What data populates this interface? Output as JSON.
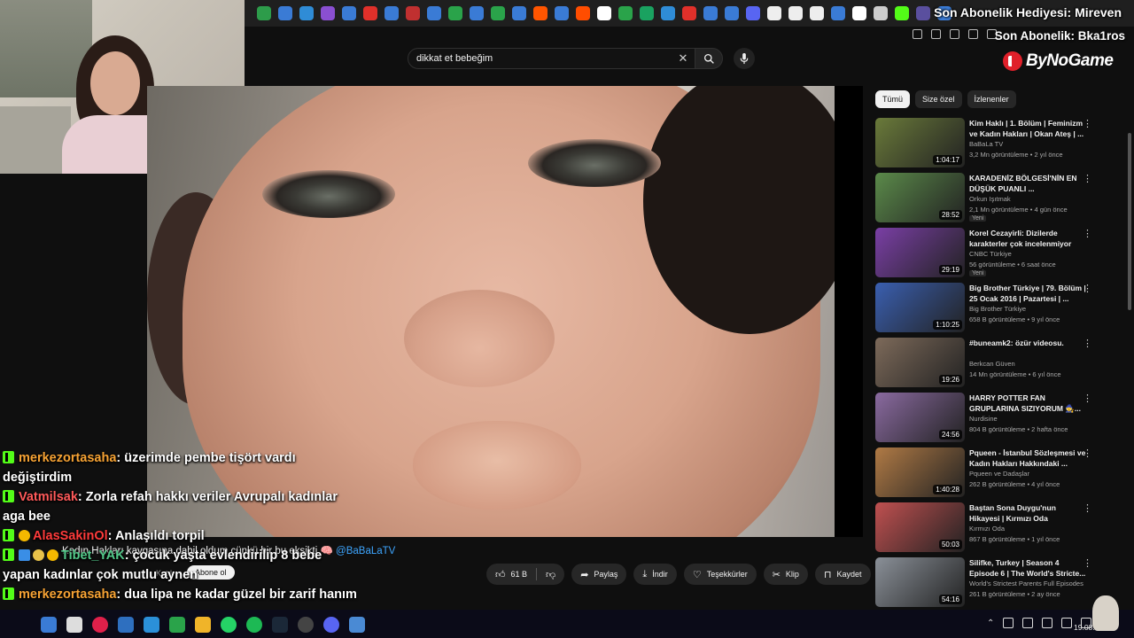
{
  "overlay": {
    "sub_gift": "Son Abonelik Hediyesi: Mireven",
    "last_sub": "Son Abonelik: Bka1ros",
    "logo_text": "ByNoGame"
  },
  "search": {
    "value": "dikkat et bebeğim"
  },
  "video": {
    "title": "Kadın Hakları kavgasına dahil oldum çünkü bir bu eksikti",
    "mention": "@BaBaLaTV",
    "join_label": "Katıl",
    "subscribe_label": "Abone ol",
    "actions": {
      "likes": "61 B",
      "share": "Paylaş",
      "download": "İndir",
      "thanks": "Teşekkürler",
      "clip": "Klip",
      "save": "Kaydet"
    }
  },
  "chat": [
    {
      "user": "merkezortasaha",
      "user_color": "#f7a334",
      "text": ": üzerimde pembe tişört vardı değiştirdim"
    },
    {
      "user": "Vatmilsak",
      "user_color": "#ff5a5a",
      "text": ": Zorla refah hakkı veriler Avrupalı kadınlar aga bee"
    },
    {
      "user": "AlasSakinOl",
      "user_color": "#ff3b3b",
      "text": ": Anlaşıldı torpil"
    },
    {
      "user": "Tibet_YAK",
      "user_color": "#53c98a",
      "text": ": çocuk yaşta evlendirilip 8 bebe yapan kadınlar çok mutlu aynen"
    },
    {
      "user": "merkezortasaha",
      "user_color": "#f7a334",
      "text": ": dua lipa ne kadar güzel bir zarif hanım"
    }
  ],
  "sidebar": {
    "chips": [
      "Tümü",
      "Size özel",
      "İzlenenler"
    ],
    "items": [
      {
        "title": "Kim Haklı | 1. Bölüm | Feminizm ve Kadın Hakları | Okan Ateş | ...",
        "channel": "BaBaLa TV",
        "meta": "3,2 Mn görüntüleme • 2 yıl önce",
        "duration": "1:04:17",
        "new": "",
        "thumb": "#6a7a3a"
      },
      {
        "title": "KARADENİZ BÖLGESİ'NİN EN DÜŞÜK PUANLI ...",
        "channel": "Orkun Işıtmak",
        "meta": "2,1 Mn görüntüleme • 4 gün önce",
        "duration": "28:52",
        "new": "Yeni",
        "thumb": "#5b8a4a"
      },
      {
        "title": "Korel Cezayirli: Dizilerde karakterler çok incelenmiyor",
        "channel": "CNBC Türkiye",
        "meta": "56 görüntüleme • 6 saat önce",
        "duration": "29:19",
        "new": "Yeni",
        "thumb": "#7a3fa5"
      },
      {
        "title": "Big Brother Türkiye | 79. Bölüm | 25 Ocak 2016 | Pazartesi | ...",
        "channel": "Big Brother Türkiye",
        "meta": "658 B görüntüleme • 9 yıl önce",
        "duration": "1:10:25",
        "new": "",
        "thumb": "#3a5fb0"
      },
      {
        "title": "#buneamk2: özür videosu.",
        "channel": "Berkcan Güven",
        "meta": "14 Mn görüntüleme • 6 yıl önce",
        "duration": "19:26",
        "new": "",
        "thumb": "#7d6a5a"
      },
      {
        "title": "HARRY POTTER FAN GRUPLARINA SIZIYORUM 🧙...",
        "channel": "Nurdisine",
        "meta": "804 B görüntüleme • 2 hafta önce",
        "duration": "24:56",
        "new": "",
        "thumb": "#8a6aa0"
      },
      {
        "title": "Pqueen - İstanbul Sözleşmesi ve Kadın Hakları Hakkındaki ...",
        "channel": "Pqueen ve Dadaşlar",
        "meta": "262 B görüntüleme • 4 yıl önce",
        "duration": "1:40:28",
        "new": "",
        "thumb": "#b07a45"
      },
      {
        "title": "Baştan Sona Duygu'nun Hikayesi | Kırmızı Oda",
        "channel": "Kırmızı Oda",
        "meta": "867 B görüntüleme • 1 yıl önce",
        "duration": "50:03",
        "new": "",
        "thumb": "#c05050"
      },
      {
        "title": "Silifke, Turkey | Season 4 Episode 6 | The World's Stricte...",
        "channel": "World's Strictest Parents Full Episodes",
        "meta": "261 B görüntüleme • 2 ay önce",
        "duration": "54:16",
        "new": "",
        "thumb": "#8a9098"
      }
    ]
  },
  "taskbar": {
    "date": "19.08.2"
  },
  "colors": {
    "accent": "#3ea6ff",
    "kick_green": "#53fc18",
    "bg": "#0f0f0f"
  }
}
